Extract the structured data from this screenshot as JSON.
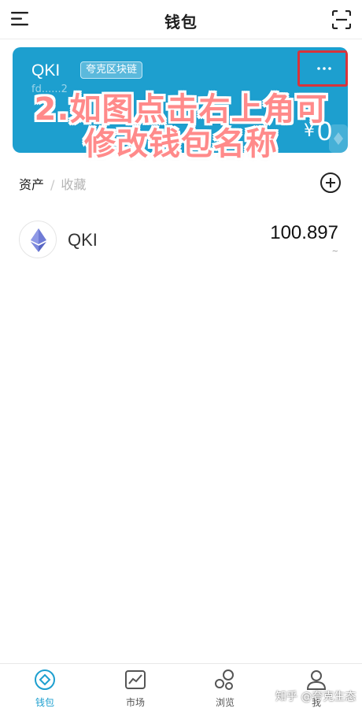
{
  "header": {
    "title": "钱包"
  },
  "wallet_card": {
    "name": "QKI",
    "chain_badge": "夸克区块链",
    "address": "fd......2",
    "currency_symbol": "¥",
    "balance": "0"
  },
  "overlay": {
    "line1": "2.如图点击右上角可",
    "line2": "修改钱包名称"
  },
  "tabs": {
    "assets": "资产",
    "separator": "/",
    "favorites": "收藏"
  },
  "assets": [
    {
      "symbol": "QKI",
      "amount": "100.897",
      "fiat": "~"
    }
  ],
  "bottom_nav": [
    {
      "label": "钱包",
      "active": true
    },
    {
      "label": "市场",
      "active": false
    },
    {
      "label": "浏览",
      "active": false
    },
    {
      "label": "我",
      "active": false
    }
  ],
  "watermark": "知乎 @夸克生态",
  "colors": {
    "accent": "#1d9fcf",
    "highlight": "#d8333a",
    "overlay_text": "#ff8a8a"
  }
}
